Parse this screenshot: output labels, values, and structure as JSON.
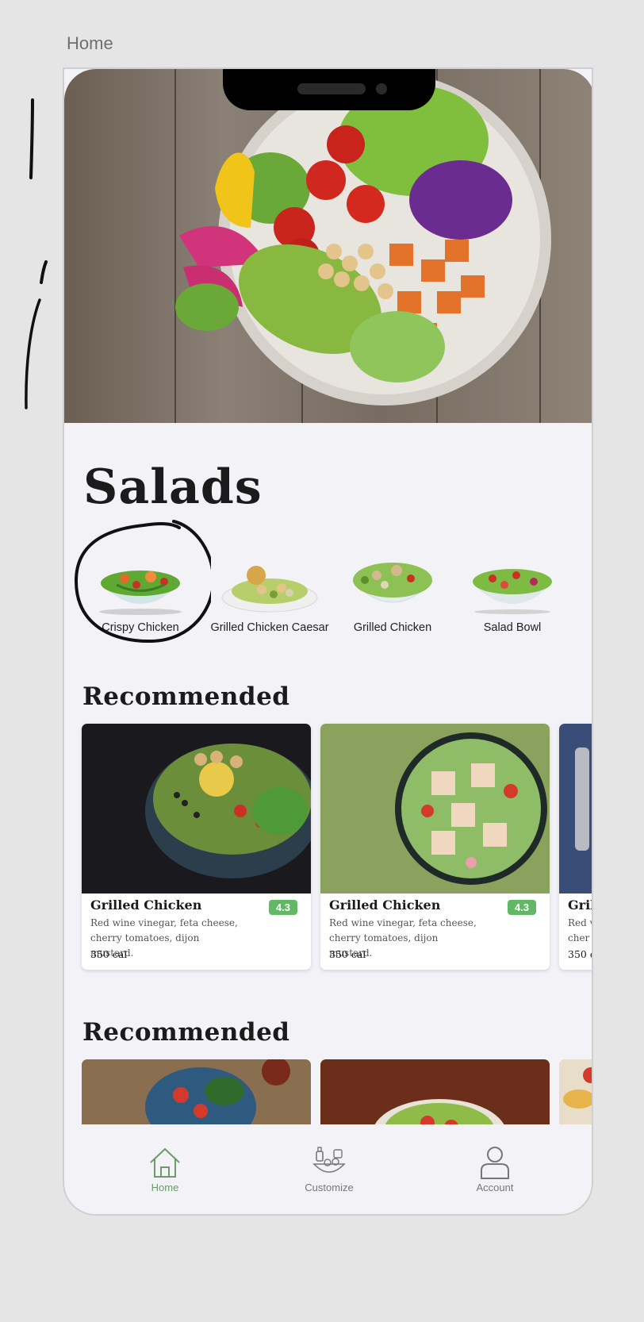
{
  "canvas": {
    "title": "Home"
  },
  "hero": {
    "image": "salad-bowl-photo"
  },
  "categories": {
    "heading": "Salads",
    "items": [
      {
        "label": "Crispy Chicken"
      },
      {
        "label": "Grilled Chicken Caesar"
      },
      {
        "label": "Grilled Chicken"
      },
      {
        "label": "Salad Bowl"
      }
    ]
  },
  "recommended": {
    "heading": "Recommended",
    "cards": [
      {
        "title": "Grilled Chicken",
        "rating": "4.3",
        "description": "Red wine vinegar, feta cheese, cherry tomatoes, dijon mustard.",
        "calories": "350 cal"
      },
      {
        "title": "Grilled Chicken",
        "rating": "4.3",
        "description": "Red wine vinegar, feta cheese, cherry tomatoes, dijon mustard.",
        "calories": "350 cal"
      },
      {
        "title": "Gril",
        "description": "Red v cher",
        "calories": "350 c"
      }
    ]
  },
  "recommended2": {
    "heading": "Recommended"
  },
  "tabbar": {
    "items": [
      {
        "label": "Home",
        "icon": "home-icon",
        "active": true
      },
      {
        "label": "Customize",
        "icon": "customize-icon",
        "active": false
      },
      {
        "label": "Account",
        "icon": "account-icon",
        "active": false
      }
    ],
    "active_color": "#6e9a6b"
  },
  "colors": {
    "rating_badge": "#62b865",
    "background": "#f2f2f7"
  }
}
